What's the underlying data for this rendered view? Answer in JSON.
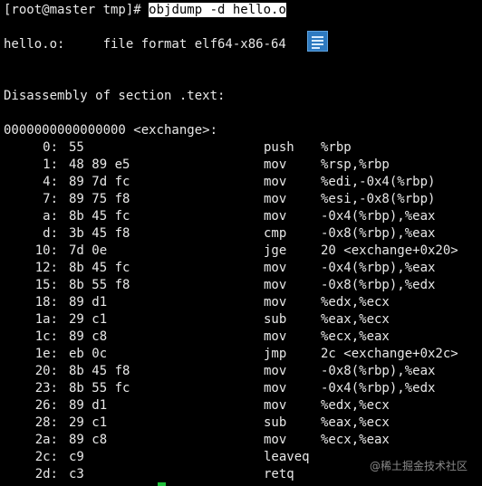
{
  "terminal": {
    "prompt": "[root@master tmp]# ",
    "command": "objdump -d hello.o",
    "file_line": "hello.o:     file format elf64-x86-64",
    "section_line": "Disassembly of section .text:",
    "symbol_line": "0000000000000000 <exchange>:",
    "doc_icon": "document-icon",
    "rows": [
      {
        "addr": "0:",
        "bytes": "55",
        "mnemonic": "push",
        "operands": "%rbp"
      },
      {
        "addr": "1:",
        "bytes": "48 89 e5",
        "mnemonic": "mov",
        "operands": "%rsp,%rbp"
      },
      {
        "addr": "4:",
        "bytes": "89 7d fc",
        "mnemonic": "mov",
        "operands": "%edi,-0x4(%rbp)"
      },
      {
        "addr": "7:",
        "bytes": "89 75 f8",
        "mnemonic": "mov",
        "operands": "%esi,-0x8(%rbp)"
      },
      {
        "addr": "a:",
        "bytes": "8b 45 fc",
        "mnemonic": "mov",
        "operands": "-0x4(%rbp),%eax"
      },
      {
        "addr": "d:",
        "bytes": "3b 45 f8",
        "mnemonic": "cmp",
        "operands": "-0x8(%rbp),%eax"
      },
      {
        "addr": "10:",
        "bytes": "7d 0e",
        "mnemonic": "jge",
        "operands": "20 <exchange+0x20>"
      },
      {
        "addr": "12:",
        "bytes": "8b 45 fc",
        "mnemonic": "mov",
        "operands": "-0x4(%rbp),%eax"
      },
      {
        "addr": "15:",
        "bytes": "8b 55 f8",
        "mnemonic": "mov",
        "operands": "-0x8(%rbp),%edx"
      },
      {
        "addr": "18:",
        "bytes": "89 d1",
        "mnemonic": "mov",
        "operands": "%edx,%ecx"
      },
      {
        "addr": "1a:",
        "bytes": "29 c1",
        "mnemonic": "sub",
        "operands": "%eax,%ecx"
      },
      {
        "addr": "1c:",
        "bytes": "89 c8",
        "mnemonic": "mov",
        "operands": "%ecx,%eax"
      },
      {
        "addr": "1e:",
        "bytes": "eb 0c",
        "mnemonic": "jmp",
        "operands": "2c <exchange+0x2c>"
      },
      {
        "addr": "20:",
        "bytes": "8b 45 f8",
        "mnemonic": "mov",
        "operands": "-0x8(%rbp),%eax"
      },
      {
        "addr": "23:",
        "bytes": "8b 55 fc",
        "mnemonic": "mov",
        "operands": "-0x4(%rbp),%edx"
      },
      {
        "addr": "26:",
        "bytes": "89 d1",
        "mnemonic": "mov",
        "operands": "%edx,%ecx"
      },
      {
        "addr": "28:",
        "bytes": "29 c1",
        "mnemonic": "sub",
        "operands": "%eax,%ecx"
      },
      {
        "addr": "2a:",
        "bytes": "89 c8",
        "mnemonic": "mov",
        "operands": "%ecx,%eax"
      },
      {
        "addr": "2c:",
        "bytes": "c9",
        "mnemonic": "leaveq",
        "operands": ""
      },
      {
        "addr": "2d:",
        "bytes": "c3",
        "mnemonic": "retq",
        "operands": ""
      }
    ]
  },
  "watermark": "@稀土掘金技术社区",
  "colors": {
    "background": "#000000",
    "text": "#e8e8e8",
    "highlight_bg": "#ffffff",
    "icon_blue": "#2e7ac0",
    "cursor_green": "#1fbf3a",
    "watermark": "#8a8a8a"
  }
}
